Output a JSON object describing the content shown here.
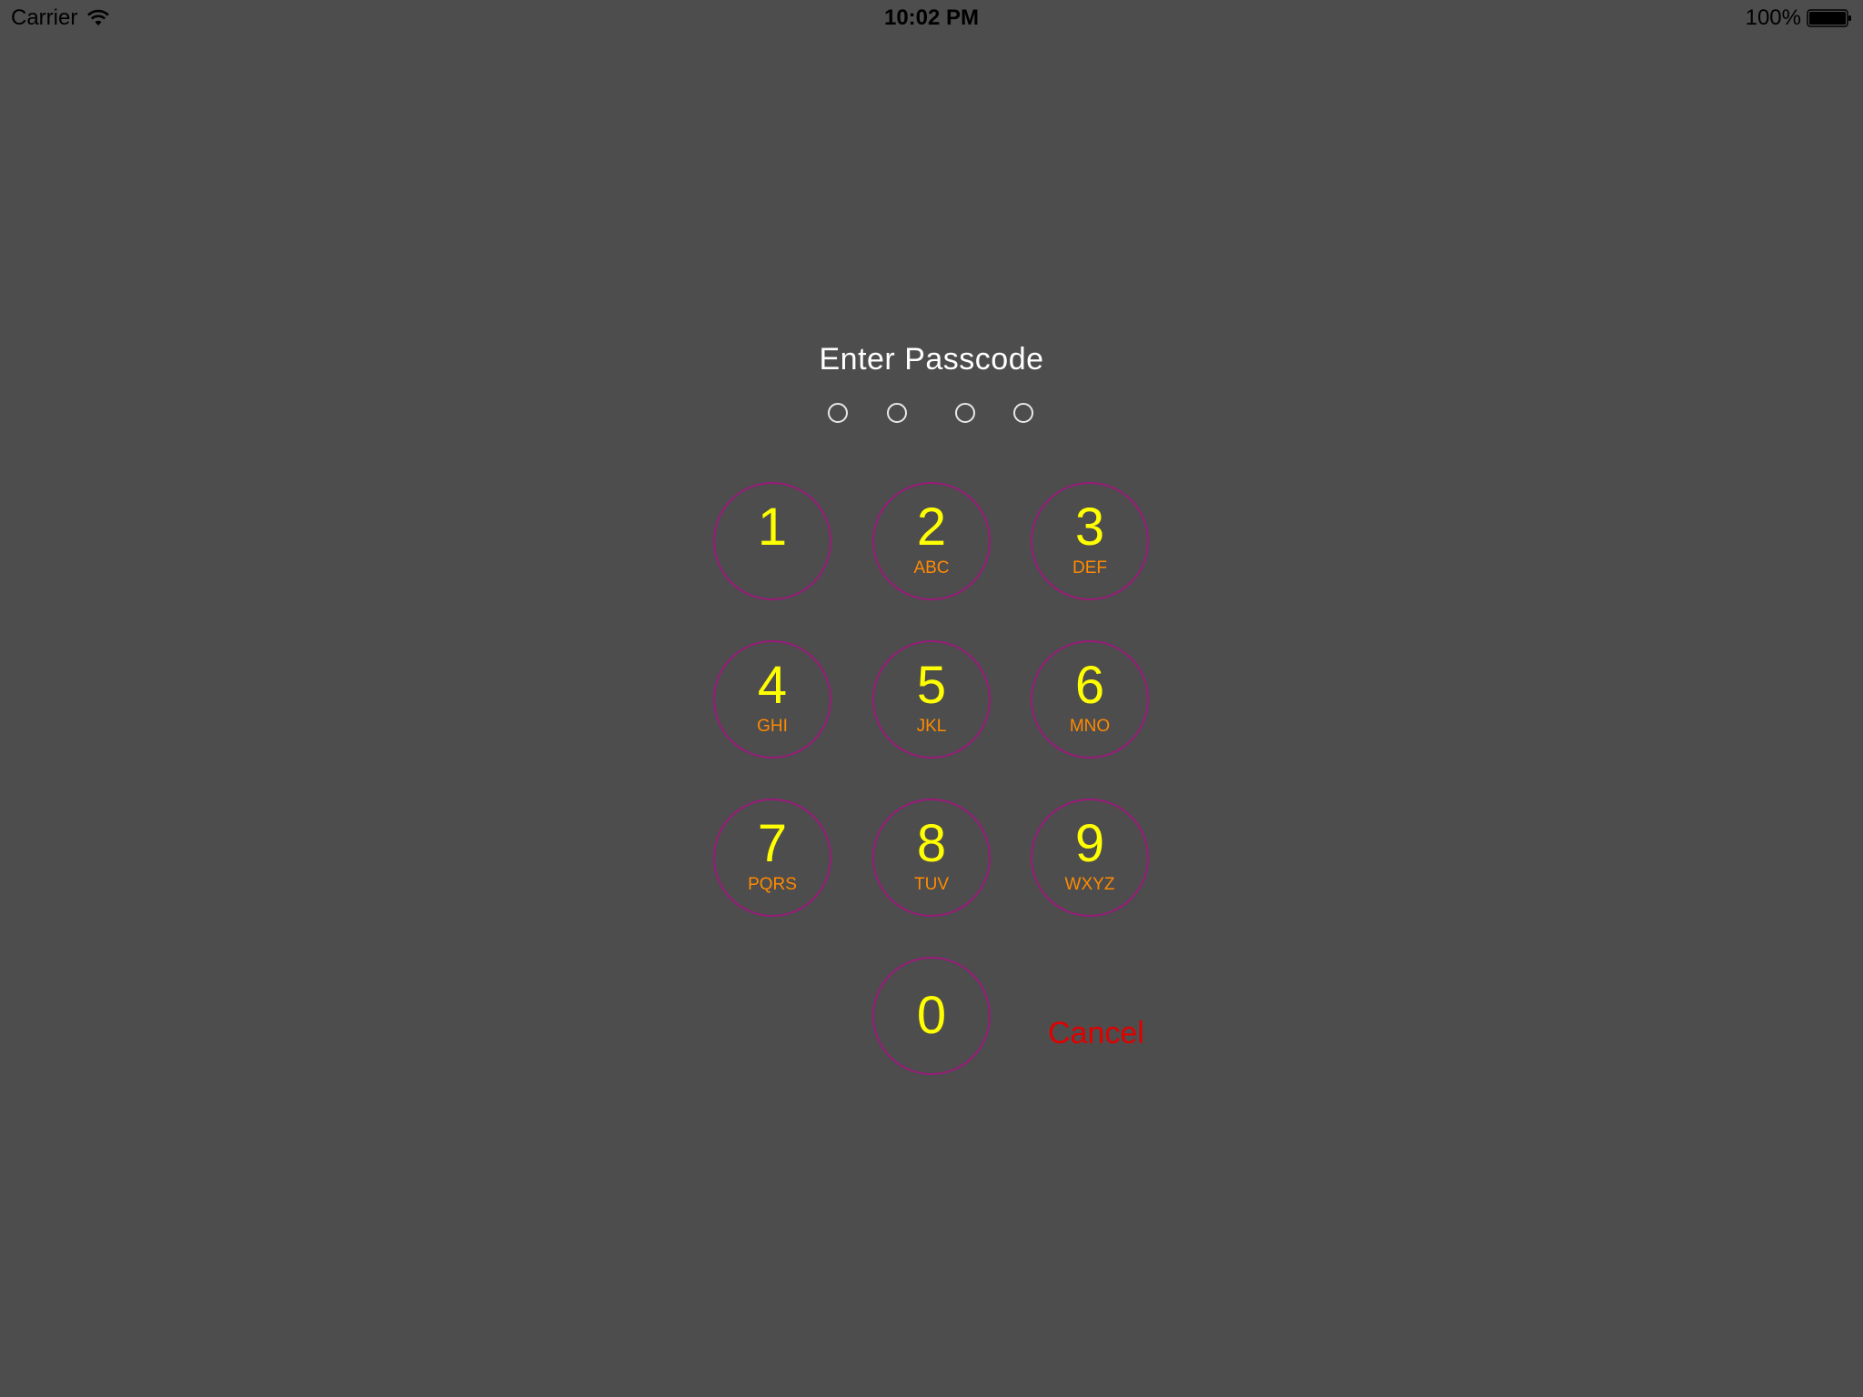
{
  "status_bar": {
    "carrier": "Carrier",
    "time": "10:02 PM",
    "battery": "100%"
  },
  "title": "Enter Passcode",
  "passcode_length": 4,
  "keypad": {
    "keys": [
      {
        "digit": "1",
        "letters": ""
      },
      {
        "digit": "2",
        "letters": "ABC"
      },
      {
        "digit": "3",
        "letters": "DEF"
      },
      {
        "digit": "4",
        "letters": "GHI"
      },
      {
        "digit": "5",
        "letters": "JKL"
      },
      {
        "digit": "6",
        "letters": "MNO"
      },
      {
        "digit": "7",
        "letters": "PQRS"
      },
      {
        "digit": "8",
        "letters": "TUV"
      },
      {
        "digit": "9",
        "letters": "WXYZ"
      },
      {
        "digit": "0",
        "letters": ""
      }
    ],
    "cancel_label": "Cancel"
  },
  "colors": {
    "background": "#4d4d4d",
    "key_border": "#9a1a7a",
    "digit": "#ffff00",
    "letters": "#ff8a00",
    "cancel": "#e00000",
    "title": "#ffffff"
  }
}
